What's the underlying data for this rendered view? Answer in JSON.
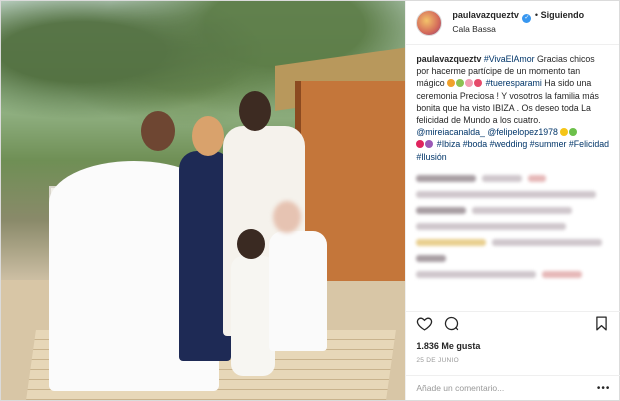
{
  "post": {
    "username": "paulavazqueztv",
    "follow_label": "Siguiendo",
    "location": "Cala Bassa",
    "caption_parts": {
      "p1": "#VivaElAmor",
      "p2": " Gracias chicos por hacerme partícipe de un momento tan mágico ",
      "p3": "#tueresparami",
      "p4": " Ha sido una ceremonia Preciosa ! Y vosotros la familia más bonita que ha visto IBIZA . Os deseo toda La felicidad de Mundo a los cuatro. ",
      "m1": "@mireiacanalda_",
      "m2": "@felipelopez1978",
      "t1": "#Ibiza",
      "t2": "#boda",
      "t3": "#wedding",
      "t4": "#summer",
      "t5": "#Felicidad",
      "t6": "#Ilusión"
    },
    "likes": "1.836 Me gusta",
    "date": "25 DE JUNIO",
    "comment_placeholder": "Añade un comentario...",
    "more_label": "•••"
  },
  "colors": {
    "hashtag": "#003569",
    "verified": "#3897f0",
    "muted": "#999999"
  },
  "icons": {
    "like": "heart-icon",
    "comment": "comment-icon",
    "save": "bookmark-icon",
    "verified": "verified-badge-icon"
  }
}
